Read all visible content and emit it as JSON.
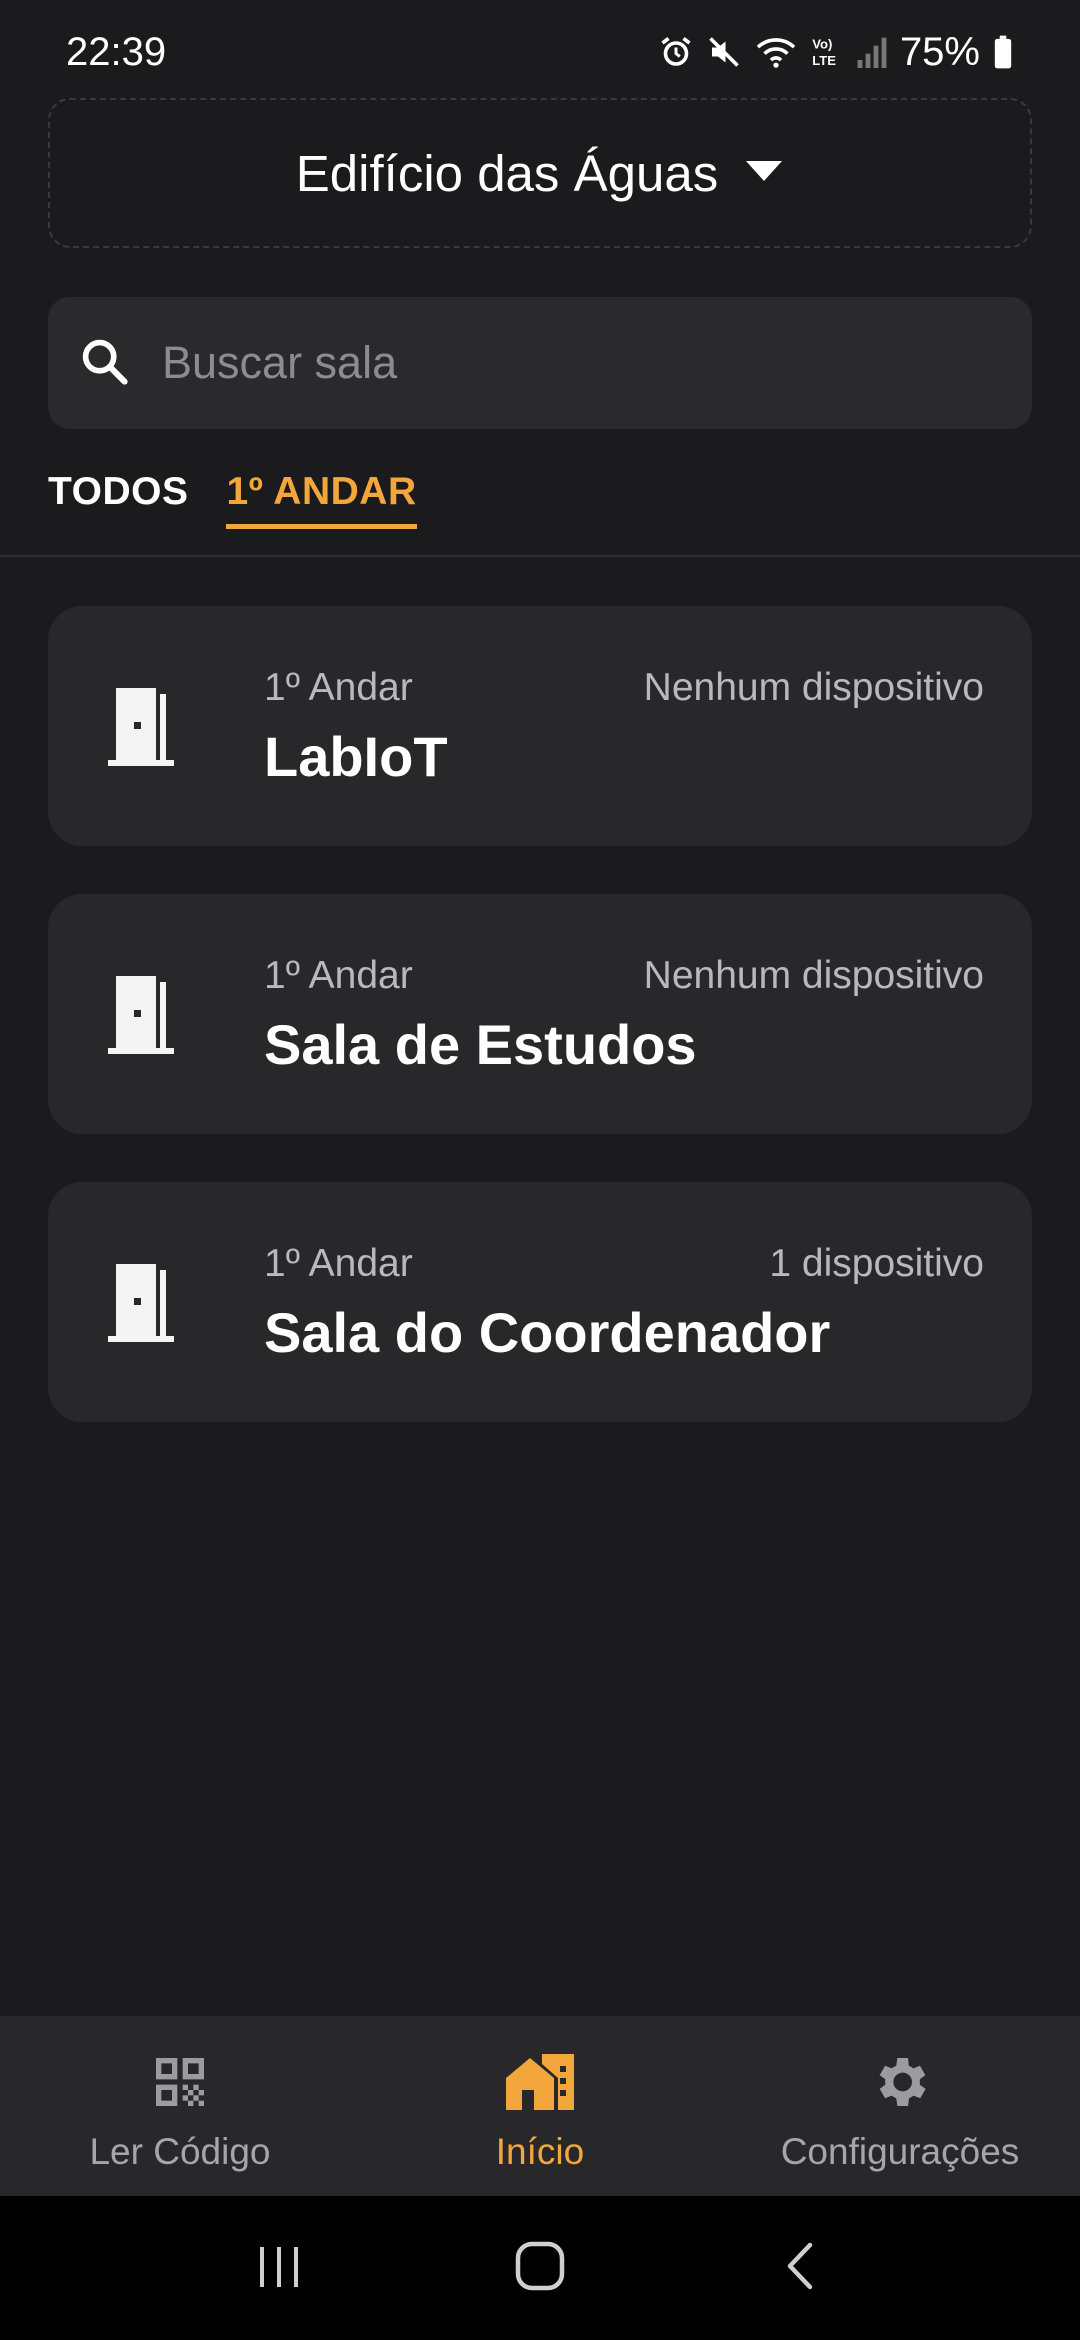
{
  "status_bar": {
    "time": "22:39",
    "battery": "75%",
    "icons": [
      "alarm-icon",
      "mute-icon",
      "wifi-icon",
      "volte-icon",
      "signal-icon",
      "battery-icon"
    ]
  },
  "building_selector": {
    "name": "Edifício das Águas",
    "icon": "caret-down-icon"
  },
  "search": {
    "placeholder": "Buscar sala",
    "value": "",
    "icon": "search-icon"
  },
  "tabs": [
    {
      "label": "TODOS",
      "active": false
    },
    {
      "label": "1º ANDAR",
      "active": true
    }
  ],
  "rooms": [
    {
      "floor": "1º Andar",
      "name": "LabIoT",
      "devices": "Nenhum dispositivo",
      "icon": "door-icon"
    },
    {
      "floor": "1º Andar",
      "name": "Sala de Estudos",
      "devices": "Nenhum dispositivo",
      "icon": "door-icon"
    },
    {
      "floor": "1º Andar",
      "name": "Sala do Coordenador",
      "devices": "1 dispositivo",
      "icon": "door-icon"
    }
  ],
  "bottom_nav": [
    {
      "label": "Ler Código",
      "icon": "qr-code-icon",
      "active": false
    },
    {
      "label": "Início",
      "icon": "home-icon",
      "active": true
    },
    {
      "label": "Configurações",
      "icon": "gear-icon",
      "active": false
    }
  ],
  "system_nav": [
    "recents-icon",
    "home-button-icon",
    "back-icon"
  ],
  "colors": {
    "background": "#1b1b1d",
    "card": "#28282b",
    "accent": "#f2a63b",
    "text_primary": "#ffffff",
    "text_secondary": "#b9b9bd"
  }
}
